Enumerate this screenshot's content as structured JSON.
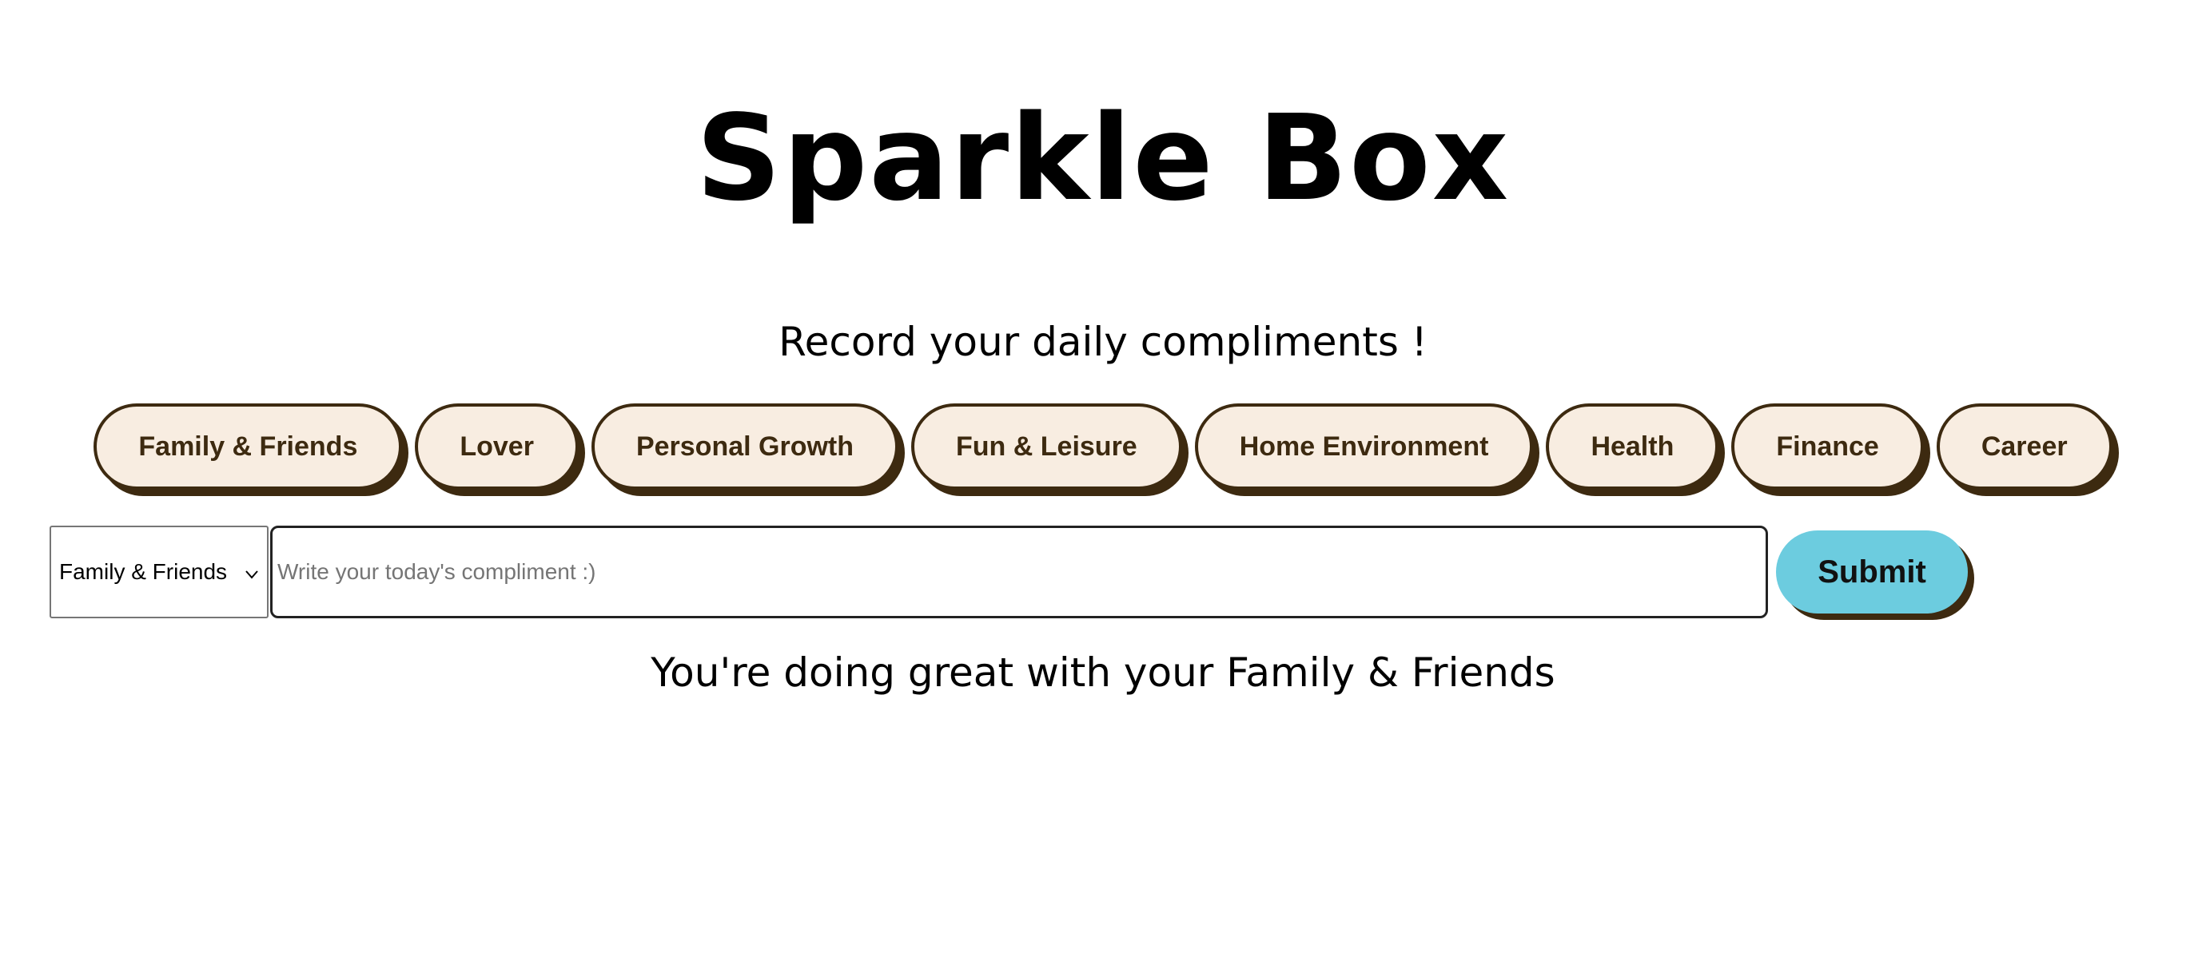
{
  "header": {
    "title": "Sparkle Box",
    "subtitle": "Record your daily compliments !"
  },
  "categories": [
    {
      "label": "Family & Friends"
    },
    {
      "label": "Lover"
    },
    {
      "label": "Personal Growth"
    },
    {
      "label": "Fun & Leisure"
    },
    {
      "label": "Home Environment"
    },
    {
      "label": "Health"
    },
    {
      "label": "Finance"
    },
    {
      "label": "Career"
    }
  ],
  "form": {
    "selected_category": "Family & Friends",
    "input_placeholder": "Write your today's compliment :)",
    "input_value": "",
    "submit_label": "Submit"
  },
  "status_message": "You're doing great with your Family & Friends",
  "colors": {
    "category_bg": "#f8ede1",
    "category_border": "#3d2a10",
    "submit_bg": "#6cccdf"
  },
  "icons": {
    "select_chevron": "chevron-down-icon"
  }
}
